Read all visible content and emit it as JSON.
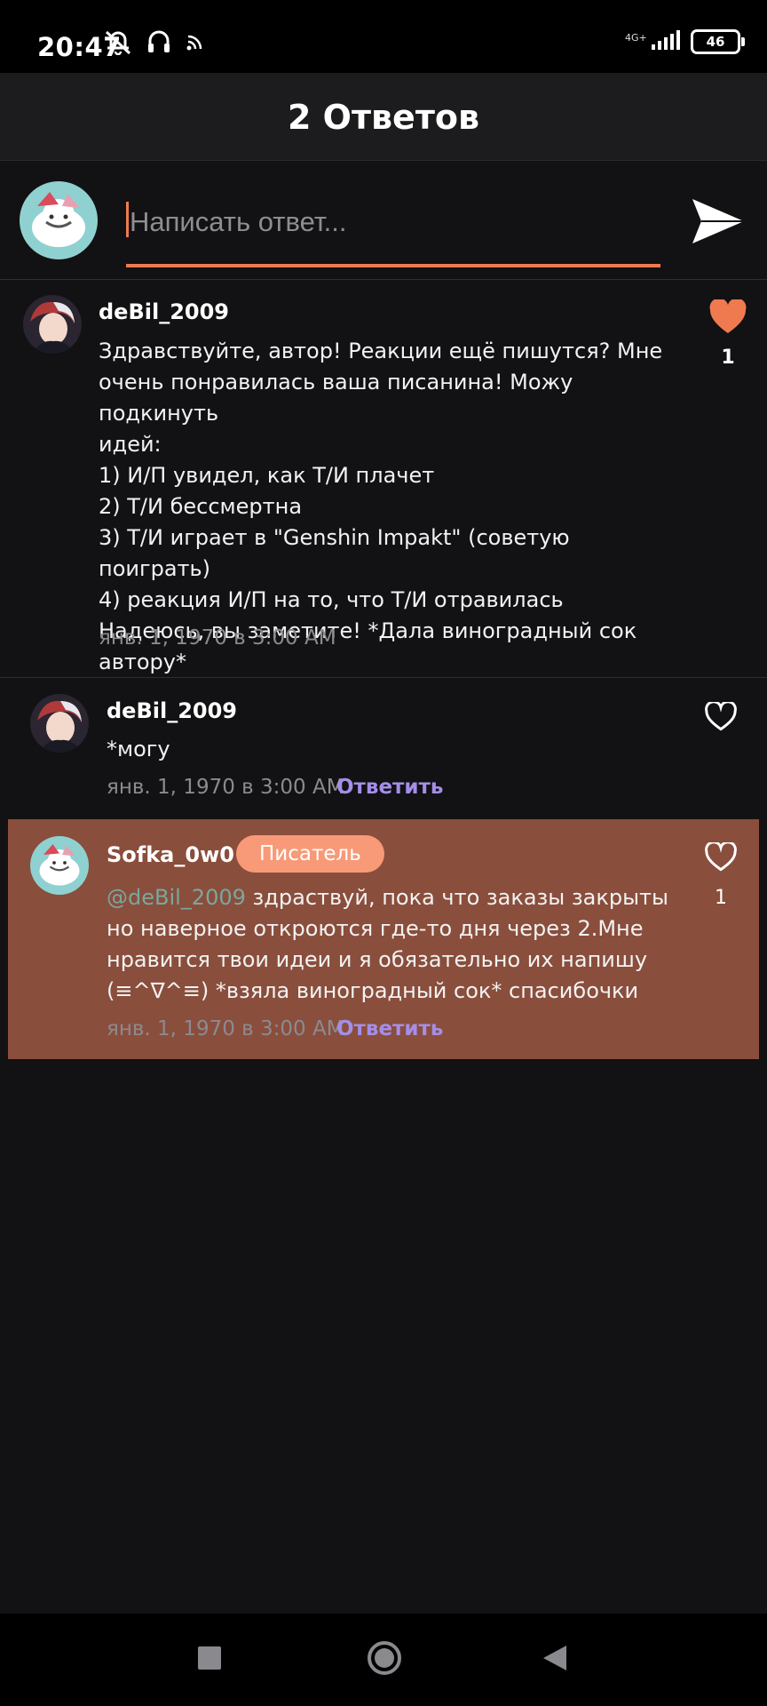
{
  "status_bar": {
    "time": "20:47",
    "network": "4G+",
    "battery": "46"
  },
  "header": {
    "title": "2 Ответов"
  },
  "reply": {
    "placeholder": "Написать ответ...",
    "send_icon": "send-icon"
  },
  "comments": [
    {
      "username": "deBil_2009",
      "text": "Здравствуйте, автор! Реакции ещё пишутся? Мне\nочень понравилась ваша писанина! Можу подкинуть\nидей:\n1) И/П увидел, как Т/И плачет\n2) Т/И бессмертна\n3) Т/И играет в \"Genshin Impakt\" (советую поиграть)\n4) реакция И/П на то,  что Т/И отравилась\nНадеюсь, вы заметите! *Дала виноградный сок\nавтору*",
      "timestamp": "янв. 1, 1970 в 3:00 AM",
      "like_count": "1",
      "liked": true
    },
    {
      "username": "deBil_2009",
      "text": "*могу",
      "timestamp": "янв. 1, 1970 в 3:00 AM",
      "reply_label": "Ответить",
      "liked": false
    },
    {
      "username": "Sofka_0w0",
      "badge": "Писатель",
      "mention": "@deBil_2009",
      "text": " здраствуй, пока что заказы закрыты\nно наверное откроются где-то дня через 2.Мне\nнравится твои идеи и я обязательно их напишу\n(≡^∇^≡) *взяла виноградный сок* спасибочки",
      "timestamp": "янв. 1, 1970 в 3:00 AM",
      "reply_label": "Ответить",
      "like_count": "1",
      "liked": false
    }
  ],
  "colors": {
    "accent": "#f07a4f",
    "highlight_bg": "#8a4e3c",
    "badge_bg": "#f89a78",
    "link": "#a48ee8",
    "mention": "#7aa79d"
  },
  "nav": {
    "recents_icon": "square-icon",
    "home_icon": "circle-icon",
    "back_icon": "triangle-back-icon"
  }
}
